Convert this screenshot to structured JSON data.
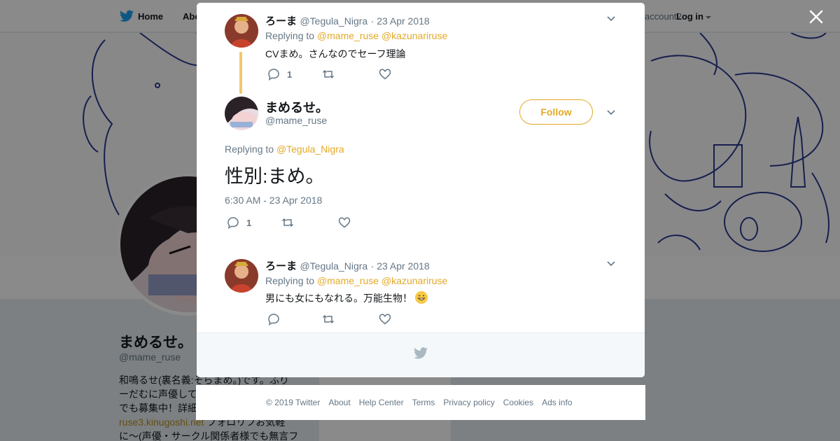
{
  "topbar": {
    "home_label": "Home",
    "about_label": "Abo",
    "account_prompt": "account?",
    "login_label": "Log in"
  },
  "profile": {
    "name": "まめるせ。",
    "handle": "@mame_ruse",
    "bio_line1": "和鳴るせ(裏名義:そらまめ。)です。ふり",
    "bio_line2": "ーだむに声優して",
    "bio_line3": "でも募集中！詳細",
    "bio_link": "ruse3.kinugoshi.net",
    "bio_line4": " フォロリフお気軽",
    "bio_line5": "に〜(声優・サークル関係者様でも無言フ"
  },
  "modal": {
    "parent_tweet": {
      "name": "ろーま",
      "handle": "@Tegula_Nigra",
      "date": "· 23 Apr 2018",
      "replying_label": "Replying to",
      "mention1": "@mame_ruse",
      "mention2": "@kazunariruse",
      "text": "CVまめ。さんなのでセーフ理論",
      "reply_count": "1"
    },
    "main_tweet": {
      "name": "まめるせ。",
      "handle": "@mame_ruse",
      "follow_label": "Follow",
      "replying_label": "Replying to",
      "mention": "@Tegula_Nigra",
      "text": "性別:まめ。",
      "timestamp": "6:30 AM - 23 Apr 2018",
      "reply_count": "1"
    },
    "reply_tweet": {
      "name": "ろーま",
      "handle": "@Tegula_Nigra",
      "date": "· 23 Apr 2018",
      "replying_label": "Replying to",
      "mention1": "@mame_ruse",
      "mention2": "@kazunariruse",
      "text": "男にも女にもなれる。万能生物！"
    },
    "footer_icon": "twitter-bird-icon"
  },
  "page_footer": {
    "copyright": "© 2019 Twitter",
    "about": "About",
    "help": "Help Center",
    "terms": "Terms",
    "privacy": "Privacy policy",
    "cookies": "Cookies",
    "ads": "Ads info"
  },
  "colors": {
    "accent": "#e3a926",
    "thread_line": "#f4c76a",
    "brand_blue": "#1da1f2",
    "muted": "#657786"
  },
  "icons": [
    "twitter-bird-icon",
    "close-icon",
    "chevron-down-icon",
    "reply-icon",
    "retweet-icon",
    "like-icon",
    "grinning-emoji-icon"
  ]
}
